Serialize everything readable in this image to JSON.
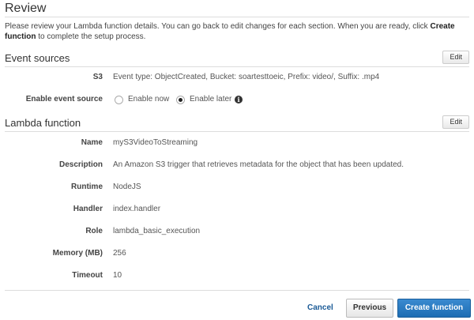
{
  "header": {
    "title": "Review",
    "intro_text": "Please review your Lambda function details. You can go back to edit changes for each section. When you are ready, click ",
    "intro_bold": "Create function",
    "intro_suffix": " to complete the setup process."
  },
  "event_sources": {
    "title": "Event sources",
    "edit_label": "Edit",
    "s3_label": "S3",
    "s3_value": "Event type: ObjectCreated, Bucket: soartesttoeic, Prefix: video/, Suffix: .mp4",
    "enable_label": "Enable event source",
    "options": [
      {
        "label": "Enable now",
        "selected": false
      },
      {
        "label": "Enable later",
        "selected": true
      }
    ]
  },
  "lambda_function": {
    "title": "Lambda function",
    "edit_label": "Edit",
    "fields": [
      {
        "label": "Name",
        "value": "myS3VideoToStreaming"
      },
      {
        "label": "Description",
        "value": "An Amazon S3 trigger that retrieves metadata for the object that has been updated."
      },
      {
        "label": "Runtime",
        "value": "NodeJS"
      },
      {
        "label": "Handler",
        "value": "index.handler"
      },
      {
        "label": "Role",
        "value": "lambda_basic_execution"
      },
      {
        "label": "Memory (MB)",
        "value": "256"
      },
      {
        "label": "Timeout",
        "value": "10"
      }
    ]
  },
  "footer": {
    "cancel_label": "Cancel",
    "previous_label": "Previous",
    "create_label": "Create function"
  },
  "icons": {
    "info": "info-icon"
  },
  "colors": {
    "primary_button": "#1d6db3",
    "link": "#1a5a96"
  }
}
